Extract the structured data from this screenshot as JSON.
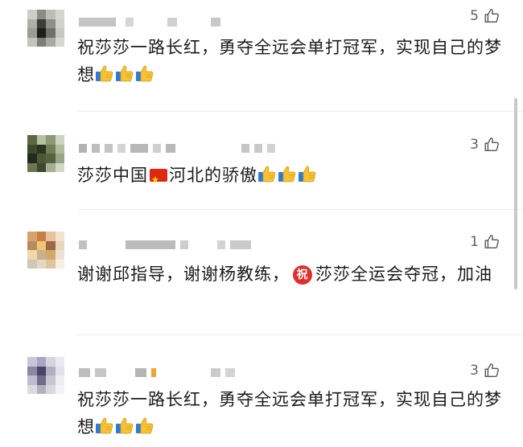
{
  "comments": [
    {
      "likes": "5",
      "text_part1": "祝莎莎一路长红，勇夺全远会单打冠军，实现自己的梦想"
    },
    {
      "likes": "3",
      "text_part1": "莎莎中国",
      "text_part2": "河北的骄傲"
    },
    {
      "likes": "1",
      "text_part1": "谢谢邱指导，谢谢杨教练，",
      "badge": "祝",
      "text_part2": "莎莎全运会夺冠，加油"
    },
    {
      "likes": "3",
      "text_part1": "祝莎莎一路长红，勇夺全远会单打冠军，实现自己的梦想"
    }
  ],
  "icons": {
    "like": "thumbs-up-outline-icon",
    "emoji": "thumbs-up-emoji",
    "flag": "china-flag-emoji"
  },
  "colors": {
    "text": "#1a1a1a",
    "like_count": "#606060",
    "badge": "#e0302d",
    "thumb": "#f2b51c"
  }
}
